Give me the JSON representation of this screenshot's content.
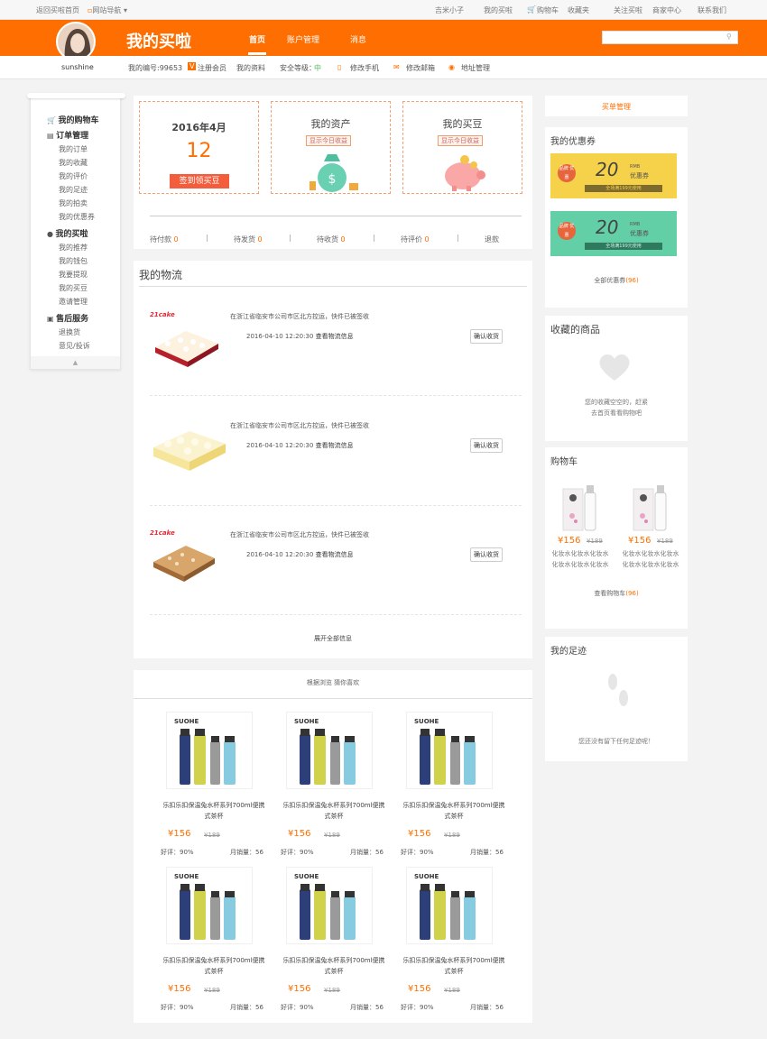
{
  "topbar": {
    "home": "返回买啦首页",
    "nav": "网站导航",
    "user": "吉米小子",
    "mybuy": "我的买啦",
    "cart": "购物车",
    "fav": "收藏夹",
    "follow": "关注买啦",
    "seller": "商家中心",
    "contact": "联系我们"
  },
  "header": {
    "brand": "我的买啦",
    "nav": [
      "首页",
      "账户管理",
      "消息"
    ],
    "search_placeholder": ""
  },
  "info": {
    "username": "sunshine",
    "id": "我的编号:99653",
    "member": "注册会员",
    "profile": "我的资料",
    "security": "安全等级：",
    "security_level": "中",
    "phone": "修改手机",
    "email": "修改邮箱",
    "address": "地址管理"
  },
  "sidebar": {
    "sections": [
      {
        "title": "我的购物车",
        "items": []
      },
      {
        "title": "订单管理",
        "items": [
          "我的订单",
          "我的收藏",
          "我的评价",
          "我的足迹",
          "我的拍卖",
          "我的优惠券"
        ]
      },
      {
        "title": "我的买啦",
        "items": [
          "我的推荐",
          "我的钱包",
          "我要提现",
          "我的买豆",
          "邀请管理"
        ]
      },
      {
        "title": "售后服务",
        "items": [
          "退换货",
          "意见/投诉"
        ]
      }
    ]
  },
  "summary": {
    "date": "2016年4月",
    "day": "12",
    "sign": "签到领买豆",
    "assets": "我的资产",
    "assets_tag": "显示今日收益",
    "beans": "我的买豆",
    "beans_tag": "显示今日收益",
    "status": [
      {
        "label": "待付款",
        "count": "0"
      },
      {
        "label": "待发货",
        "count": "0"
      },
      {
        "label": "待收货",
        "count": "0"
      },
      {
        "label": "待评价",
        "count": "0"
      },
      {
        "label": "退款",
        "count": ""
      }
    ]
  },
  "logistics": {
    "title": "我的物流",
    "expand": "展开全部信息",
    "items": [
      {
        "brand": "21cake",
        "text": "在浙江省临安市公司市区北方控运，快件已被签收",
        "time": "2016-04-10 12:20:30",
        "link": "查看物流信息",
        "btn": "确认收货"
      },
      {
        "brand": "",
        "text": "在浙江省临安市公司市区北方控运，快件已被签收",
        "time": "2016-04-10 12:20:30",
        "link": "查看物流信息",
        "btn": "确认收货"
      },
      {
        "brand": "21cake",
        "text": "在浙江省临安市公司市区北方控运，快件已被签收",
        "time": "2016-04-10 12:20:30",
        "link": "查看物流信息",
        "btn": "确认收货"
      }
    ]
  },
  "recommend": {
    "title": "根据浏览 猜你喜欢",
    "products": [
      {
        "brand": "SUOHE",
        "name": "乐扣乐扣保温兔水杯系列700ml便携式茶杯",
        "price": "¥156",
        "old": "¥189",
        "rate": "好评：90%",
        "sales": "月销量：56"
      },
      {
        "brand": "SUOHE",
        "name": "乐扣乐扣保温兔水杯系列700ml便携式茶杯",
        "price": "¥156",
        "old": "¥189",
        "rate": "好评：90%",
        "sales": "月销量：56"
      },
      {
        "brand": "SUOHE",
        "name": "乐扣乐扣保温兔水杯系列700ml便携式茶杯",
        "price": "¥156",
        "old": "¥189",
        "rate": "好评：90%",
        "sales": "月销量：56"
      },
      {
        "brand": "SUOHE",
        "name": "乐扣乐扣保温兔水杯系列700ml便携式茶杯",
        "price": "¥156",
        "old": "¥189",
        "rate": "好评：90%",
        "sales": "月销量：56"
      },
      {
        "brand": "SUOHE",
        "name": "乐扣乐扣保温兔水杯系列700ml便携式茶杯",
        "price": "¥156",
        "old": "¥189",
        "rate": "好评：90%",
        "sales": "月销量：56"
      },
      {
        "brand": "SUOHE",
        "name": "乐扣乐扣保温兔水杯系列700ml便携式茶杯",
        "price": "¥156",
        "old": "¥189",
        "rate": "好评：90%",
        "sales": "月销量：56"
      }
    ]
  },
  "right": {
    "orders": "买单管理",
    "coupon_title": "我的优惠券",
    "coupons": [
      {
        "tag": "品牌 优惠",
        "amount": "20",
        "unit": "RMB",
        "label": "优惠券",
        "cond": "全场满199元使用"
      },
      {
        "tag": "品牌 优惠",
        "amount": "20",
        "unit": "RMB",
        "label": "优惠券",
        "cond": "全场满199元使用"
      }
    ],
    "all_coupons": "全部优惠券",
    "coupon_count": "(96)",
    "fav_title": "收藏的商品",
    "fav_empty1": "您的收藏空空的，赶紧",
    "fav_empty2": "去首页看看购物吧",
    "cart_title": "购物车",
    "cart_items": [
      {
        "price": "¥156",
        "old": "¥189",
        "name": "化妆水化妆水化妆水化妆水化妆水化妆水"
      },
      {
        "price": "¥156",
        "old": "¥189",
        "name": "化妆水化妆水化妆水化妆水化妆水化妆水"
      }
    ],
    "cart_link": "查看购物车",
    "cart_count": "(96)",
    "foot_title": "我的足迹",
    "foot_empty": "您还没有留下任何足迹呢！"
  },
  "colors": {
    "accent": "#ff6e00",
    "coupon_yellow": "#f6d24a",
    "coupon_green": "#62cfa6"
  }
}
